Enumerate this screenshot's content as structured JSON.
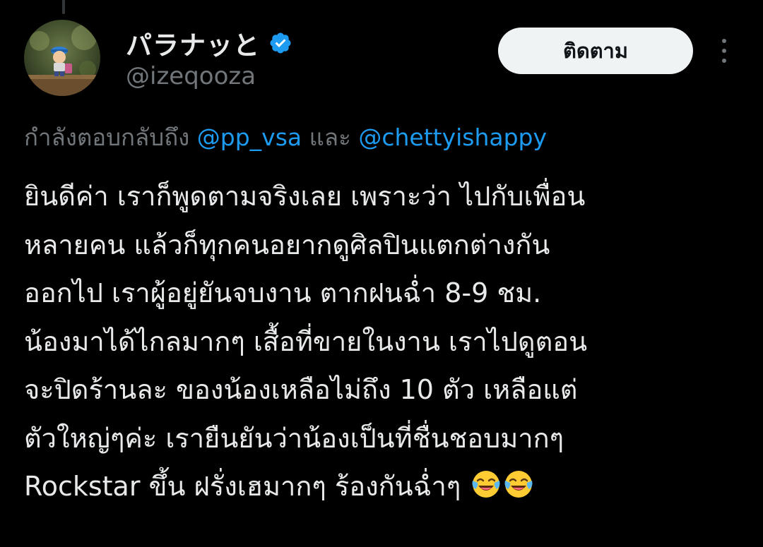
{
  "author": {
    "display_name": "パラナッと",
    "handle": "@izeqooza",
    "verified": true,
    "avatar": "avatar-figurine-photo"
  },
  "actions": {
    "follow_label": "ติดตาม",
    "more_icon": "more-vertical-icon"
  },
  "reply_context": {
    "prefix": "กำลังตอบกลับถึง ",
    "mention_1": "@pp_vsa",
    "conjunction": " และ ",
    "mention_2": "@chettyishappy"
  },
  "tweet": {
    "lines": [
      "ยินดีค่า เราก็พูดตามจริงเลย เพราะว่า ไปกับเพื่อน",
      "หลายคน แล้วก็ทุกคนอยากดูศิลปินแตกต่างกัน",
      "ออกไป เราผู้อยู่ยันจบงาน ตากฝนฉ่ำ 8-9 ชม.",
      "น้องมาได้ไกลมากๆ เสื้อที่ขายในงาน เราไปดูตอน",
      "จะปิดร้านละ ของน้องเหลือไม่ถึง 10 ตัว เหลือแต่",
      "ตัวใหญ่ๆค่ะ เรายืนยันว่าน้องเป็นที่ชื่นชอบมากๆ",
      "Rockstar ขึ้น ฝรั่งเฮมากๆ ร้องกันฉ่ำๆ "
    ],
    "emoji": [
      "face-with-tears-of-joy",
      "face-with-tears-of-joy"
    ]
  },
  "colors": {
    "background": "#000000",
    "text": "#e7e9ea",
    "muted": "#71767b",
    "link": "#1d9bf0",
    "follow_bg": "#eff3f4"
  }
}
